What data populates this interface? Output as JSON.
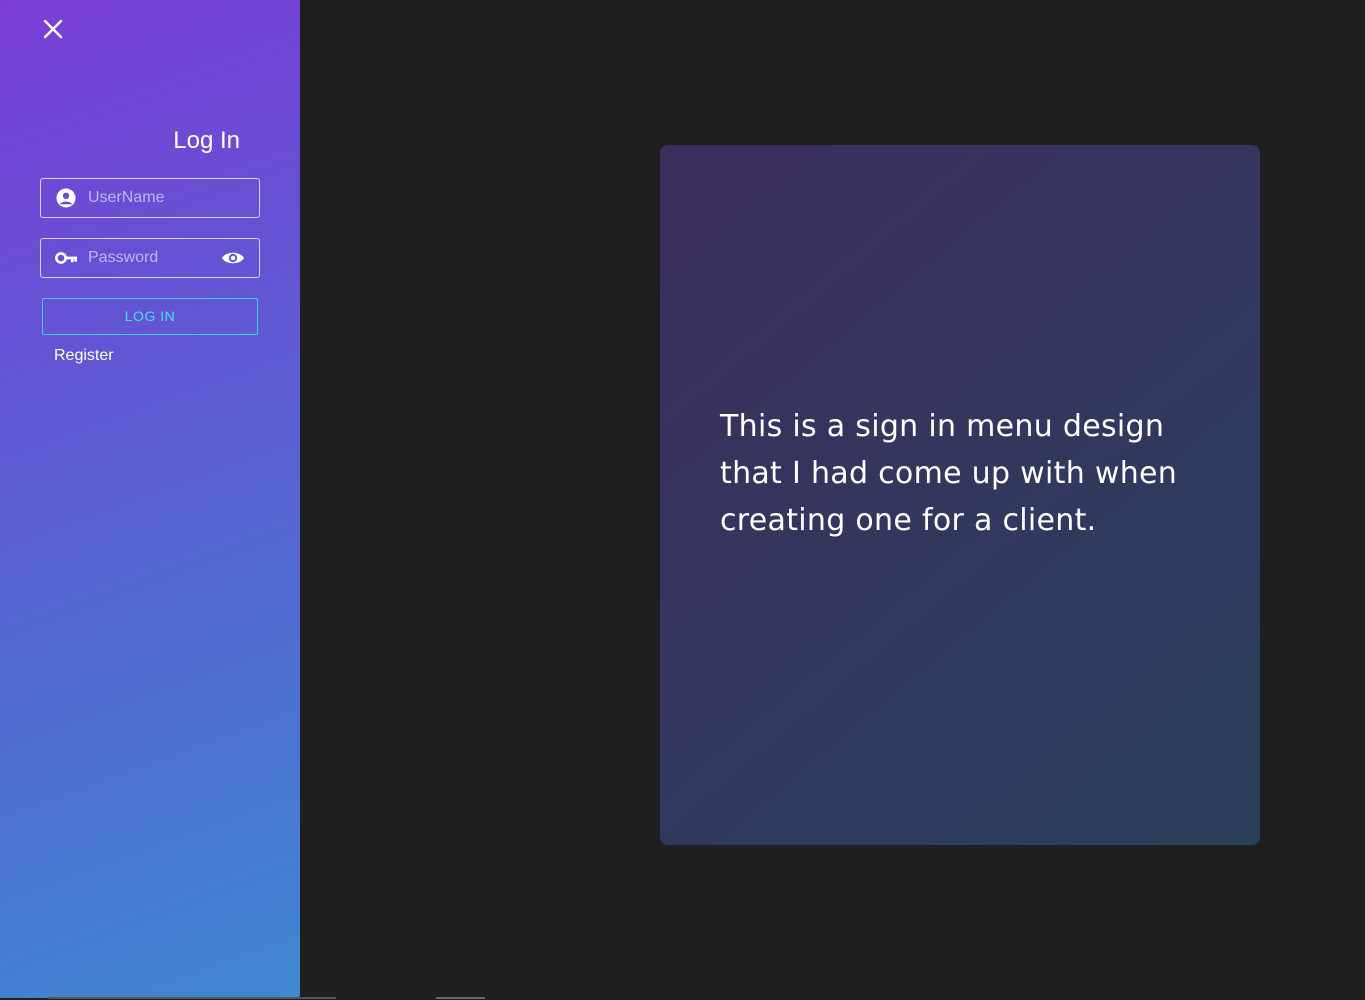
{
  "sidebar": {
    "title": "Log In",
    "username": {
      "placeholder": "UserName",
      "value": ""
    },
    "password": {
      "placeholder": "Password",
      "value": ""
    },
    "login_button": "LOG IN",
    "register_link": "Register",
    "icons": {
      "close": "close-icon",
      "user": "account-circle-icon",
      "key": "key-icon",
      "visibility": "eye-icon"
    }
  },
  "card": {
    "text": "This is a sign in menu design that I had come up with when creating one for a client."
  },
  "colors": {
    "background": "#1f1f1f",
    "sidebar_gradient_start": "#7a3ed6",
    "sidebar_gradient_end": "#3f88d0",
    "accent": "#3ee6f2",
    "card_gradient_start": "#3b2d5c",
    "card_gradient_end": "#2b405a"
  }
}
